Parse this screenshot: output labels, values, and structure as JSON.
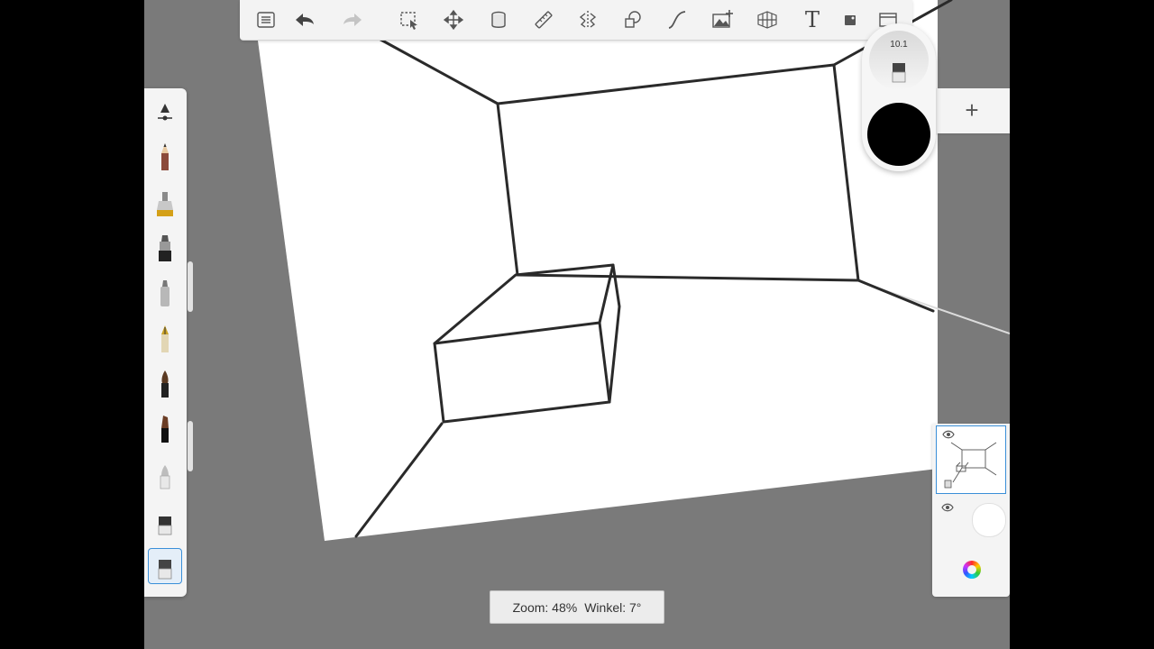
{
  "toolbar": {
    "tools": [
      {
        "name": "layer-list-icon"
      },
      {
        "name": "undo-icon"
      },
      {
        "name": "redo-icon"
      },
      {
        "name": "selection-icon"
      },
      {
        "name": "transform-icon"
      },
      {
        "name": "fill-bucket-icon"
      },
      {
        "name": "ruler-icon"
      },
      {
        "name": "symmetry-icon"
      },
      {
        "name": "shape-icon"
      },
      {
        "name": "curve-icon"
      },
      {
        "name": "image-insert-icon"
      },
      {
        "name": "perspective-grid-icon"
      },
      {
        "name": "text-icon",
        "glyph": "T"
      },
      {
        "name": "stencil-icon"
      },
      {
        "name": "fullscreen-icon"
      }
    ]
  },
  "brushes": [
    "brush-settings-icon",
    "pencil-icon",
    "airbrush-icon",
    "ink-pen-icon",
    "marker-icon",
    "fountain-pen-icon",
    "paintbrush-icon",
    "chisel-brush-icon",
    "soft-eraser-icon",
    "eraser-block-icon",
    "hard-eraser-icon"
  ],
  "puck": {
    "brush_size": "10.1",
    "color": "#000000"
  },
  "layers": {
    "add_glyph": "+",
    "items": [
      {
        "name": "layer-1",
        "visible": true,
        "selected": true
      },
      {
        "name": "background-layer",
        "visible": true,
        "selected": false
      }
    ]
  },
  "hud": {
    "zoom": "Zoom: 48%",
    "angle": "Winkel: 7°"
  },
  "colors": {
    "canvas_background": "#7a7a7a",
    "paper": "#ffffff",
    "accent": "#3a8fd8",
    "stroke": "#2a2a2a"
  }
}
